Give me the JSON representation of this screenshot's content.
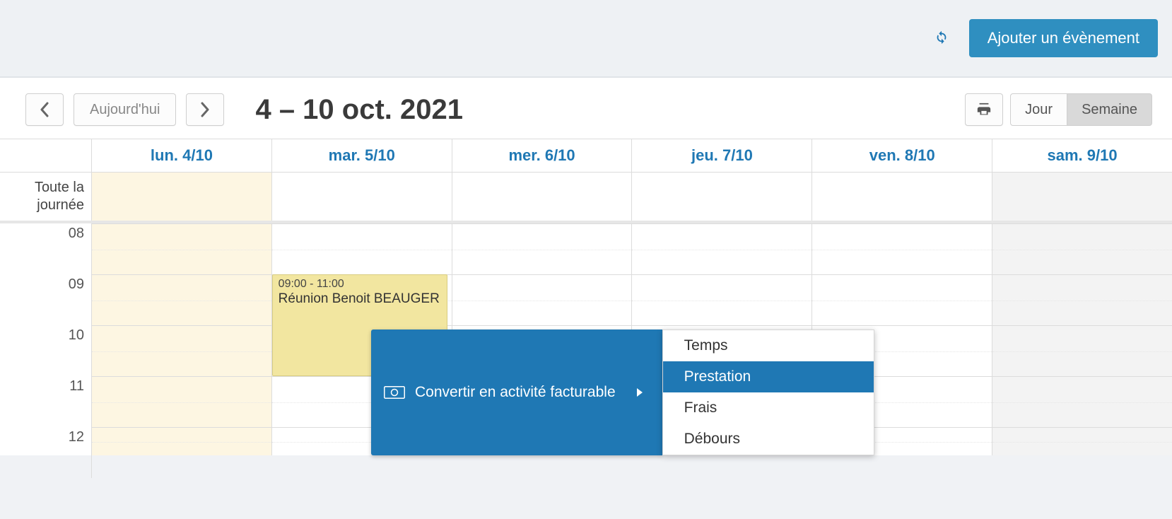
{
  "topbar": {
    "add_label": "Ajouter un évènement"
  },
  "toolbar": {
    "today_label": "Aujourd'hui",
    "title": "4 – 10 oct. 2021",
    "day_label": "Jour",
    "week_label": "Semaine"
  },
  "calendar": {
    "allday_label": "Toute la journée",
    "days": [
      "lun. 4/10",
      "mar. 5/10",
      "mer. 6/10",
      "jeu. 7/10",
      "ven. 8/10",
      "sam. 9/10"
    ],
    "hours": [
      "08",
      "09",
      "10",
      "11",
      "12"
    ],
    "event": {
      "time": "09:00 - 11:00",
      "title": "Réunion Benoit BEAUGER"
    }
  },
  "context_menu": {
    "main_label": "Convertir en activité facturable",
    "items": [
      "Temps",
      "Prestation",
      "Frais",
      "Débours"
    ],
    "hover_index": 1
  }
}
